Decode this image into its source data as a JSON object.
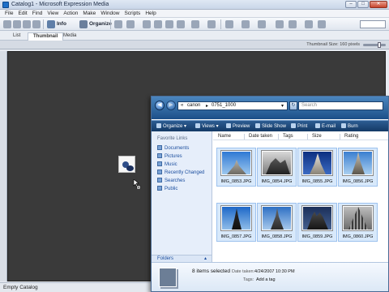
{
  "app": {
    "title": "Catalog1 - Microsoft Expression Media",
    "menu": [
      "File",
      "Edit",
      "Find",
      "View",
      "Action",
      "Make",
      "Window",
      "Scripts",
      "Help"
    ],
    "toolbar": {
      "info_label": "Info",
      "organize_label": "Organize"
    },
    "tabs": [
      "List",
      "Thumbnail",
      "Media"
    ],
    "active_tab": "Thumbnail",
    "thumbnail_size_label": "Thumbnail Size: 160 pixels",
    "thumbnail_size_value": 160,
    "status": "Empty Catalog"
  },
  "explorer": {
    "breadcrumb": [
      "canon",
      "0751_1000"
    ],
    "search_placeholder": "Search",
    "commands": [
      "Organize",
      "Views",
      "Preview",
      "Slide Show",
      "Print",
      "E-mail",
      "Burn"
    ],
    "favorite_links_header": "Favorite Links",
    "favorites": [
      "Documents",
      "Pictures",
      "Music",
      "Recently Changed",
      "Searches",
      "Public"
    ],
    "folders_label": "Folders",
    "columns": [
      "Name",
      "Date taken",
      "Tags",
      "Size",
      "Rating"
    ],
    "files": [
      {
        "name": "IMG_0853.JPG"
      },
      {
        "name": "IMG_0854.JPG"
      },
      {
        "name": "IMG_0855.JPG"
      },
      {
        "name": "IMG_0856.JPG"
      },
      {
        "name": "IMG_0857.JPG"
      },
      {
        "name": "IMG_0858.JPG"
      },
      {
        "name": "IMG_0859.JPG"
      },
      {
        "name": "IMG_0860.JPG"
      }
    ],
    "details": {
      "items_selected": "8 items selected",
      "date_taken_label": "Date taken:",
      "date_taken_value": "4/24/2007 10:30 PM",
      "tags_label": "Tags:",
      "tags_value": "Add a tag"
    }
  },
  "colors": {
    "viewer_background": "#3a3a3a",
    "explorer_chrome": "#1c4f88",
    "selection_fill": "#d8e9fb",
    "link_blue": "#1a4d9e"
  }
}
